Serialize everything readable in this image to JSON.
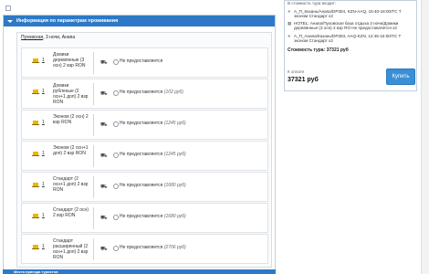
{
  "panel": {
    "title": "Информация по параметрам проживания",
    "summary_prefix": "Пуховская",
    "summary_suffix": ", 3 ночи, Анапа"
  },
  "rooms": [
    {
      "num": "1",
      "title": "Домики деревянные (3 осн) 2 взр RON",
      "option": "Не предоставляется",
      "price": ""
    },
    {
      "num": "1",
      "title": "Домики рубленые (2 осн+1 доп) 2 взр RON",
      "option": "Не предоставляется",
      "price": "(102 руб)"
    },
    {
      "num": "1",
      "title": "Эконом (2 осн) 2 взр RON",
      "option": "Не предоставляется",
      "price": "(1245 руб)"
    },
    {
      "num": "1",
      "title": "Эконом (2 осн+1 доп) 2 взр RON",
      "option": "Не предоставляется",
      "price": "(1245 руб)"
    },
    {
      "num": "1",
      "title": "Стандарт (2 осн+1 доп) 2 взр RON",
      "option": "Не предоставляется",
      "price": "(1680 руб)"
    },
    {
      "num": "1",
      "title": "Стандарт (2 осн) 2 взр RON",
      "option": "Не предоставляется",
      "price": "(1680 руб)"
    },
    {
      "num": "1",
      "title": "Стандарт расширенный (2 осн+1 доп) 2 взр RON",
      "option": "Не предоставляется",
      "price": "(2706 руб)"
    }
  ],
  "panel2": {
    "title": "Места приезда туристов"
  },
  "sidebar": {
    "head": "В стоимость тура входит:",
    "lines": [
      {
        "icon": "plane-icon",
        "glyph": "✈",
        "text": "А_П_Казань/Анапа/DP304, KZN-AAQ, 15:40-18:00/ТС Т эконом Стандарт х2"
      },
      {
        "icon": "hotel-icon",
        "glyph": "▦",
        "text": "HOTEL: Анапа/Пуховская база отдыха 3 ночи/Домики деревянные (3 осн) 2 взр RO Не предоставляется х2"
      },
      {
        "icon": "plane-icon",
        "glyph": "✈",
        "text": "А_П_Анапа/Казань/DP303, AAQ-KZN, 12:45-15:00/ТС Т эконом Стандарт х2"
      }
    ],
    "cost": "Стоимость тура: 37321 руб",
    "pay_label": "К оплате",
    "pay_value": "37321 руб",
    "buy": "Купить"
  }
}
